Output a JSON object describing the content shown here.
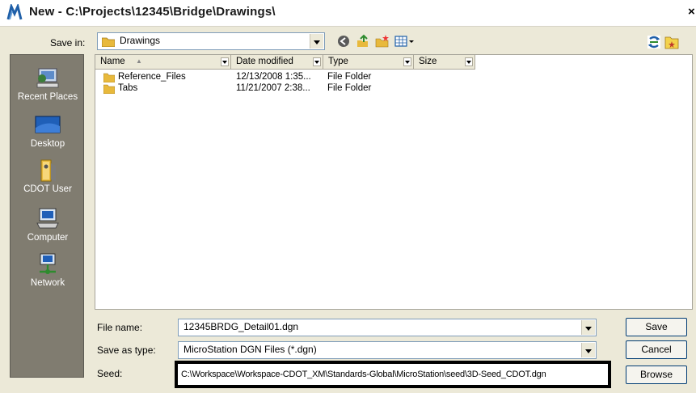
{
  "window": {
    "title": "New - C:\\Projects\\12345\\Bridge\\Drawings\\",
    "close_glyph": "×"
  },
  "toolbar": {
    "save_in_label": "Save in:",
    "save_in_value": "Drawings",
    "icons": [
      "back-icon",
      "up-folder-icon",
      "new-folder-icon",
      "views-menu-icon",
      "refresh-icon",
      "favorites-folder-icon"
    ]
  },
  "places": [
    {
      "label": "Recent Places",
      "icon": "recent-places-icon"
    },
    {
      "label": "Desktop",
      "icon": "desktop-icon"
    },
    {
      "label": "CDOT User",
      "icon": "user-folder-icon"
    },
    {
      "label": "Computer",
      "icon": "computer-icon"
    },
    {
      "label": "Network",
      "icon": "network-icon"
    }
  ],
  "columns": [
    "Name",
    "Date modified",
    "Type",
    "Size"
  ],
  "sort_glyph": "▲",
  "files": [
    {
      "name": "Reference_Files",
      "date": "12/13/2008 1:35...",
      "type": "File Folder"
    },
    {
      "name": "Tabs",
      "date": "11/21/2007 2:38...",
      "type": "File Folder"
    }
  ],
  "form": {
    "file_name_label": "File name:",
    "file_name_value": "12345BRDG_Detail01.dgn",
    "save_as_type_label": "Save as type:",
    "save_as_type_value": "MicroStation DGN Files (*.dgn)",
    "seed_label": "Seed:",
    "seed_value": "C:\\Workspace\\Workspace-CDOT_XM\\Standards-Global\\MicroStation\\seed\\3D-Seed_CDOT.dgn"
  },
  "buttons": {
    "save": "Save",
    "cancel": "Cancel",
    "browse": "Browse"
  },
  "colors": {
    "dialog_bg": "#ece9d8",
    "places_bg": "#807c70",
    "seed_highlight": "#000000"
  }
}
